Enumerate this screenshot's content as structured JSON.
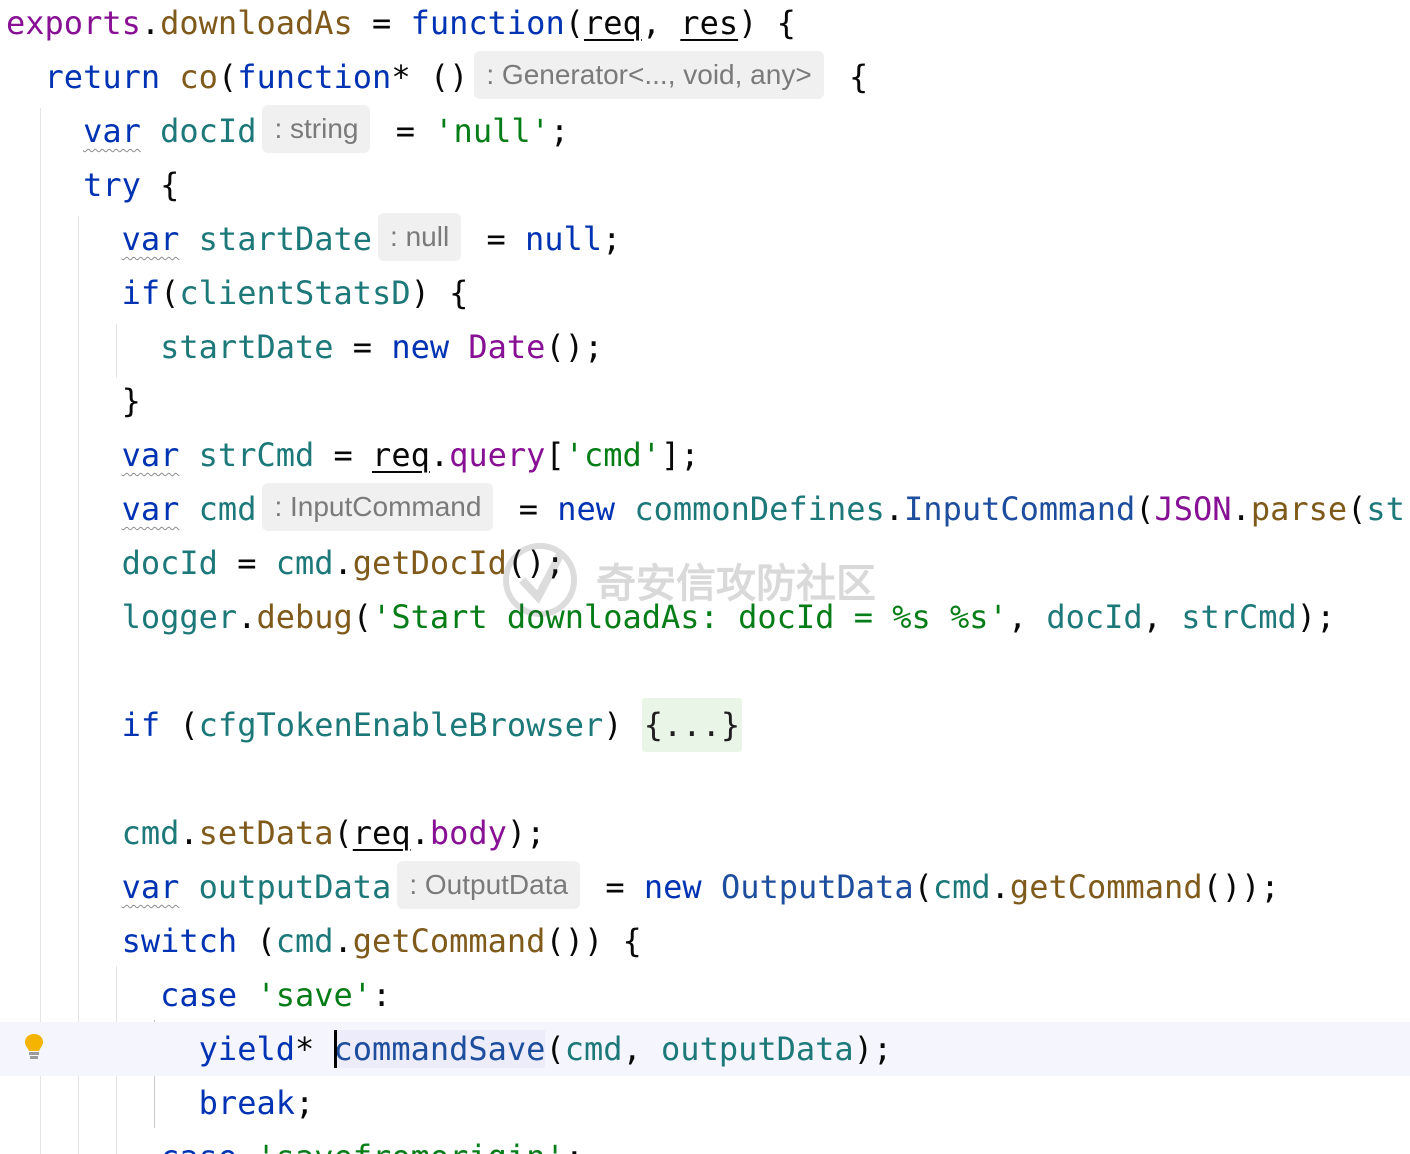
{
  "code": {
    "lines": [
      [
        {
          "c": "prop",
          "t": "exports"
        },
        {
          "c": "txt",
          "t": "."
        },
        {
          "c": "fn",
          "t": "downloadAs"
        },
        {
          "c": "txt",
          "t": " = "
        },
        {
          "c": "kw",
          "t": "function"
        },
        {
          "c": "txt",
          "t": "("
        },
        {
          "c": "txt ul",
          "t": "req"
        },
        {
          "c": "txt",
          "t": ", "
        },
        {
          "c": "txt ul",
          "t": "res"
        },
        {
          "c": "txt",
          "t": ") {"
        }
      ],
      [
        {
          "c": "txt",
          "t": "  "
        },
        {
          "c": "kw",
          "t": "return "
        },
        {
          "c": "fn",
          "t": "co"
        },
        {
          "c": "txt",
          "t": "("
        },
        {
          "c": "kw",
          "t": "function"
        },
        {
          "c": "txt",
          "t": "* ()"
        },
        {
          "c": "hint",
          "t": ": Generator<..., void, any>"
        },
        {
          "c": "txt",
          "t": " {"
        }
      ],
      [
        {
          "c": "txt",
          "t": "    "
        },
        {
          "c": "kw ul-wavy",
          "t": "var"
        },
        {
          "c": "txt",
          "t": " "
        },
        {
          "c": "var",
          "t": "docId"
        },
        {
          "c": "hint",
          "t": ": string"
        },
        {
          "c": "txt",
          "t": " = "
        },
        {
          "c": "str",
          "t": "'null'"
        },
        {
          "c": "txt",
          "t": ";"
        }
      ],
      [
        {
          "c": "txt",
          "t": "    "
        },
        {
          "c": "kw",
          "t": "try"
        },
        {
          "c": "txt",
          "t": " {"
        }
      ],
      [
        {
          "c": "txt",
          "t": "      "
        },
        {
          "c": "kw ul-wavy",
          "t": "var"
        },
        {
          "c": "txt",
          "t": " "
        },
        {
          "c": "var",
          "t": "startDate"
        },
        {
          "c": "hint",
          "t": ": null"
        },
        {
          "c": "txt",
          "t": " = "
        },
        {
          "c": "kw",
          "t": "null"
        },
        {
          "c": "txt",
          "t": ";"
        }
      ],
      [
        {
          "c": "txt",
          "t": "      "
        },
        {
          "c": "kw",
          "t": "if"
        },
        {
          "c": "txt",
          "t": "("
        },
        {
          "c": "var",
          "t": "clientStatsD"
        },
        {
          "c": "txt",
          "t": ") {"
        }
      ],
      [
        {
          "c": "txt",
          "t": "        "
        },
        {
          "c": "var",
          "t": "startDate"
        },
        {
          "c": "txt",
          "t": " = "
        },
        {
          "c": "kw",
          "t": "new "
        },
        {
          "c": "prop",
          "t": "Date"
        },
        {
          "c": "txt",
          "t": "();"
        }
      ],
      [
        {
          "c": "txt",
          "t": "      }"
        }
      ],
      [
        {
          "c": "txt",
          "t": "      "
        },
        {
          "c": "kw ul-wavy",
          "t": "var"
        },
        {
          "c": "txt",
          "t": " "
        },
        {
          "c": "var",
          "t": "strCmd"
        },
        {
          "c": "txt",
          "t": " = "
        },
        {
          "c": "txt ul",
          "t": "req"
        },
        {
          "c": "txt",
          "t": "."
        },
        {
          "c": "prop",
          "t": "query"
        },
        {
          "c": "txt",
          "t": "["
        },
        {
          "c": "str",
          "t": "'cmd'"
        },
        {
          "c": "txt",
          "t": "];"
        }
      ],
      [
        {
          "c": "txt",
          "t": "      "
        },
        {
          "c": "kw ul-wavy",
          "t": "var"
        },
        {
          "c": "txt",
          "t": " "
        },
        {
          "c": "var",
          "t": "cmd"
        },
        {
          "c": "hint",
          "t": ": InputCommand"
        },
        {
          "c": "txt",
          "t": " = "
        },
        {
          "c": "kw",
          "t": "new "
        },
        {
          "c": "var",
          "t": "commonDefines"
        },
        {
          "c": "txt",
          "t": "."
        },
        {
          "c": "cls",
          "t": "InputCommand"
        },
        {
          "c": "txt",
          "t": "("
        },
        {
          "c": "prop",
          "t": "JSON"
        },
        {
          "c": "txt",
          "t": "."
        },
        {
          "c": "fn",
          "t": "parse"
        },
        {
          "c": "txt",
          "t": "("
        },
        {
          "c": "var",
          "t": "strCmd"
        },
        {
          "c": "txt",
          "t": "));"
        }
      ],
      [
        {
          "c": "txt",
          "t": "      "
        },
        {
          "c": "var",
          "t": "docId"
        },
        {
          "c": "txt",
          "t": " = "
        },
        {
          "c": "var",
          "t": "cmd"
        },
        {
          "c": "txt",
          "t": "."
        },
        {
          "c": "fn",
          "t": "getDocId"
        },
        {
          "c": "txt",
          "t": "();"
        }
      ],
      [
        {
          "c": "txt",
          "t": "      "
        },
        {
          "c": "var",
          "t": "logger"
        },
        {
          "c": "txt",
          "t": "."
        },
        {
          "c": "fn",
          "t": "debug"
        },
        {
          "c": "txt",
          "t": "("
        },
        {
          "c": "str",
          "t": "'Start downloadAs: docId = %s %s'"
        },
        {
          "c": "txt",
          "t": ", "
        },
        {
          "c": "var",
          "t": "docId"
        },
        {
          "c": "txt",
          "t": ", "
        },
        {
          "c": "var",
          "t": "strCmd"
        },
        {
          "c": "txt",
          "t": ");"
        }
      ],
      [],
      [
        {
          "c": "txt",
          "t": "      "
        },
        {
          "c": "kw",
          "t": "if"
        },
        {
          "c": "txt",
          "t": " ("
        },
        {
          "c": "var",
          "t": "cfgTokenEnableBrowser"
        },
        {
          "c": "txt",
          "t": ") "
        },
        {
          "c": "fold",
          "t": "{...}"
        }
      ],
      [],
      [
        {
          "c": "txt",
          "t": "      "
        },
        {
          "c": "var",
          "t": "cmd"
        },
        {
          "c": "txt",
          "t": "."
        },
        {
          "c": "fn",
          "t": "setData"
        },
        {
          "c": "txt",
          "t": "("
        },
        {
          "c": "txt ul",
          "t": "req"
        },
        {
          "c": "txt",
          "t": "."
        },
        {
          "c": "prop",
          "t": "body"
        },
        {
          "c": "txt",
          "t": ");"
        }
      ],
      [
        {
          "c": "txt",
          "t": "      "
        },
        {
          "c": "kw ul-wavy",
          "t": "var"
        },
        {
          "c": "txt",
          "t": " "
        },
        {
          "c": "var",
          "t": "outputData"
        },
        {
          "c": "hint",
          "t": ": OutputData"
        },
        {
          "c": "txt",
          "t": " = "
        },
        {
          "c": "kw",
          "t": "new "
        },
        {
          "c": "cls",
          "t": "OutputData"
        },
        {
          "c": "txt",
          "t": "("
        },
        {
          "c": "var",
          "t": "cmd"
        },
        {
          "c": "txt",
          "t": "."
        },
        {
          "c": "fn",
          "t": "getCommand"
        },
        {
          "c": "txt",
          "t": "());"
        }
      ],
      [
        {
          "c": "txt",
          "t": "      "
        },
        {
          "c": "kw",
          "t": "switch"
        },
        {
          "c": "txt",
          "t": " ("
        },
        {
          "c": "var",
          "t": "cmd"
        },
        {
          "c": "txt",
          "t": "."
        },
        {
          "c": "fn",
          "t": "getCommand"
        },
        {
          "c": "txt",
          "t": "()) {"
        }
      ],
      [
        {
          "c": "txt",
          "t": "        "
        },
        {
          "c": "kw",
          "t": "case "
        },
        {
          "c": "str",
          "t": "'save'"
        },
        {
          "c": "txt",
          "t": ":"
        }
      ],
      [
        {
          "c": "txt",
          "t": "          "
        },
        {
          "c": "kw",
          "t": "yield"
        },
        {
          "c": "txt",
          "t": "* "
        },
        {
          "c": "caret",
          "t": ""
        },
        {
          "c": "cls ident-hl",
          "t": "commandSave"
        },
        {
          "c": "txt",
          "t": "("
        },
        {
          "c": "var",
          "t": "cmd"
        },
        {
          "c": "txt",
          "t": ", "
        },
        {
          "c": "var",
          "t": "outputData"
        },
        {
          "c": "txt",
          "t": ");"
        }
      ],
      [
        {
          "c": "txt",
          "t": "          "
        },
        {
          "c": "kw",
          "t": "break"
        },
        {
          "c": "txt",
          "t": ";"
        }
      ],
      [
        {
          "c": "txt",
          "t": "        "
        },
        {
          "c": "kw",
          "t": "case "
        },
        {
          "c": "str",
          "t": "'savefromorigin'"
        },
        {
          "c": "txt",
          "t": ":"
        }
      ]
    ],
    "current_line": 19
  },
  "watermark": {
    "text": "奇安信攻防社区"
  },
  "gutter": {
    "intention_icon": "lightbulb-icon"
  }
}
